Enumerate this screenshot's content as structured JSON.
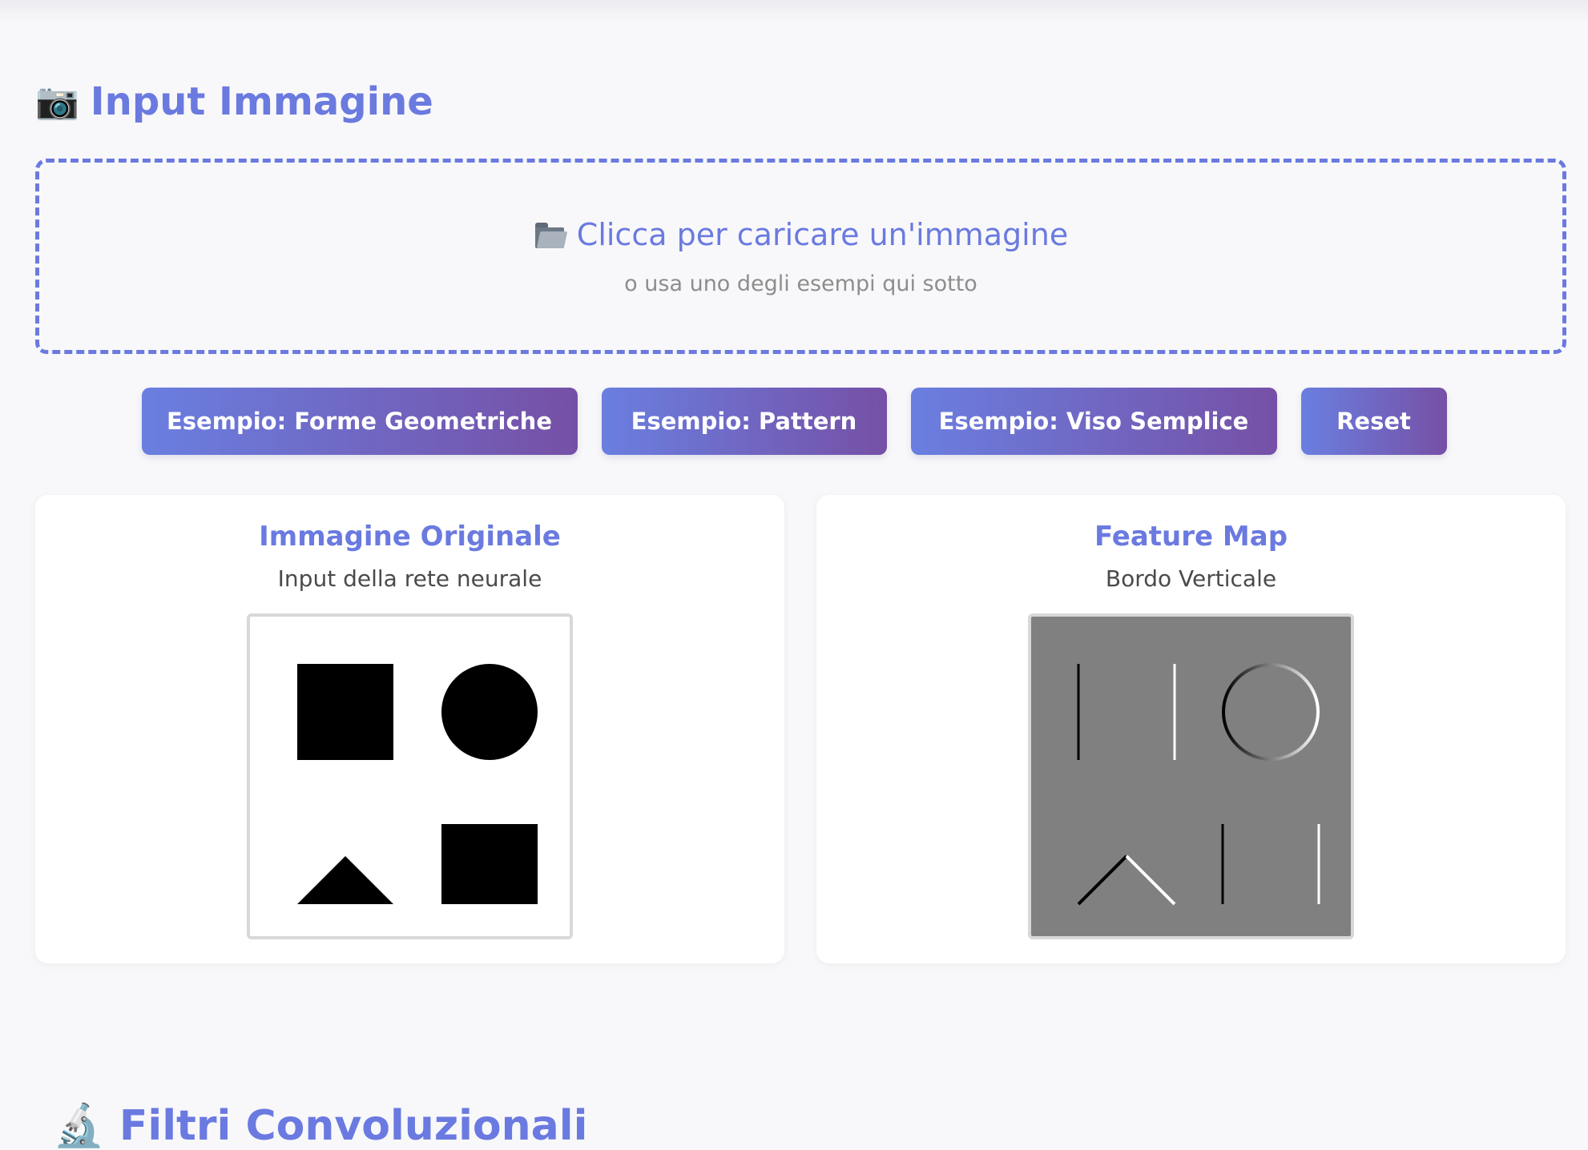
{
  "section": {
    "emoji": "📷",
    "title": "Input Immagine"
  },
  "upload": {
    "main_text": "Clicca per caricare un'immagine",
    "sub_text": "o usa uno degli esempi qui sotto",
    "icon": "folder-icon"
  },
  "buttons": {
    "geometric": "Esempio: Forme Geometriche",
    "pattern": "Esempio: Pattern",
    "face": "Esempio: Viso Semplice",
    "reset": "Reset"
  },
  "cards": {
    "original": {
      "title": "Immagine Originale",
      "subtitle": "Input della rete neurale"
    },
    "feature": {
      "title": "Feature Map",
      "subtitle": "Bordo Verticale"
    }
  },
  "next_section": {
    "emoji": "🔬",
    "title": "Filtri Convoluzionali"
  },
  "colors": {
    "accent": "#6a7ae0",
    "button_gradient_start": "#6a7fe0",
    "button_gradient_end": "#7650a6",
    "feature_background": "#808080"
  }
}
